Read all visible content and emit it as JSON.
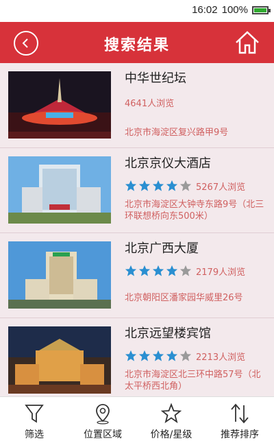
{
  "status": {
    "time": "16:02",
    "battery": "100%",
    "battery_level": 1.0
  },
  "header": {
    "title": "搜索结果"
  },
  "results": [
    {
      "name": "中华世纪坛",
      "rating": null,
      "views": "4641人浏览",
      "address": "北京市海淀区复兴路甲9号"
    },
    {
      "name": "北京京仪大酒店",
      "rating": 4,
      "rating_max": 5,
      "views": "5267人浏览",
      "address": "北京市海淀区大钟寺东路9号（北三环联想桥向东500米）"
    },
    {
      "name": "北京广西大厦",
      "rating": 4,
      "rating_max": 5,
      "views": "2179人浏览",
      "address": "北京朝阳区潘家园华威里26号"
    },
    {
      "name": "北京远望楼宾馆",
      "rating": 4,
      "rating_max": 5,
      "views": "2213人浏览",
      "address": "北京市海淀区北三环中路57号（北太平桥西北角）"
    }
  ],
  "bottom_tabs": [
    {
      "label": "筛选",
      "icon": "filter-icon"
    },
    {
      "label": "位置区域",
      "icon": "location-pin-icon"
    },
    {
      "label": "价格/星级",
      "icon": "star-icon"
    },
    {
      "label": "推荐排序",
      "icon": "sort-icon"
    }
  ],
  "colors": {
    "accent": "#d7323a",
    "star": "#2a8fd1",
    "star_empty": "#9a9a9a",
    "meta_text": "#d06060"
  }
}
